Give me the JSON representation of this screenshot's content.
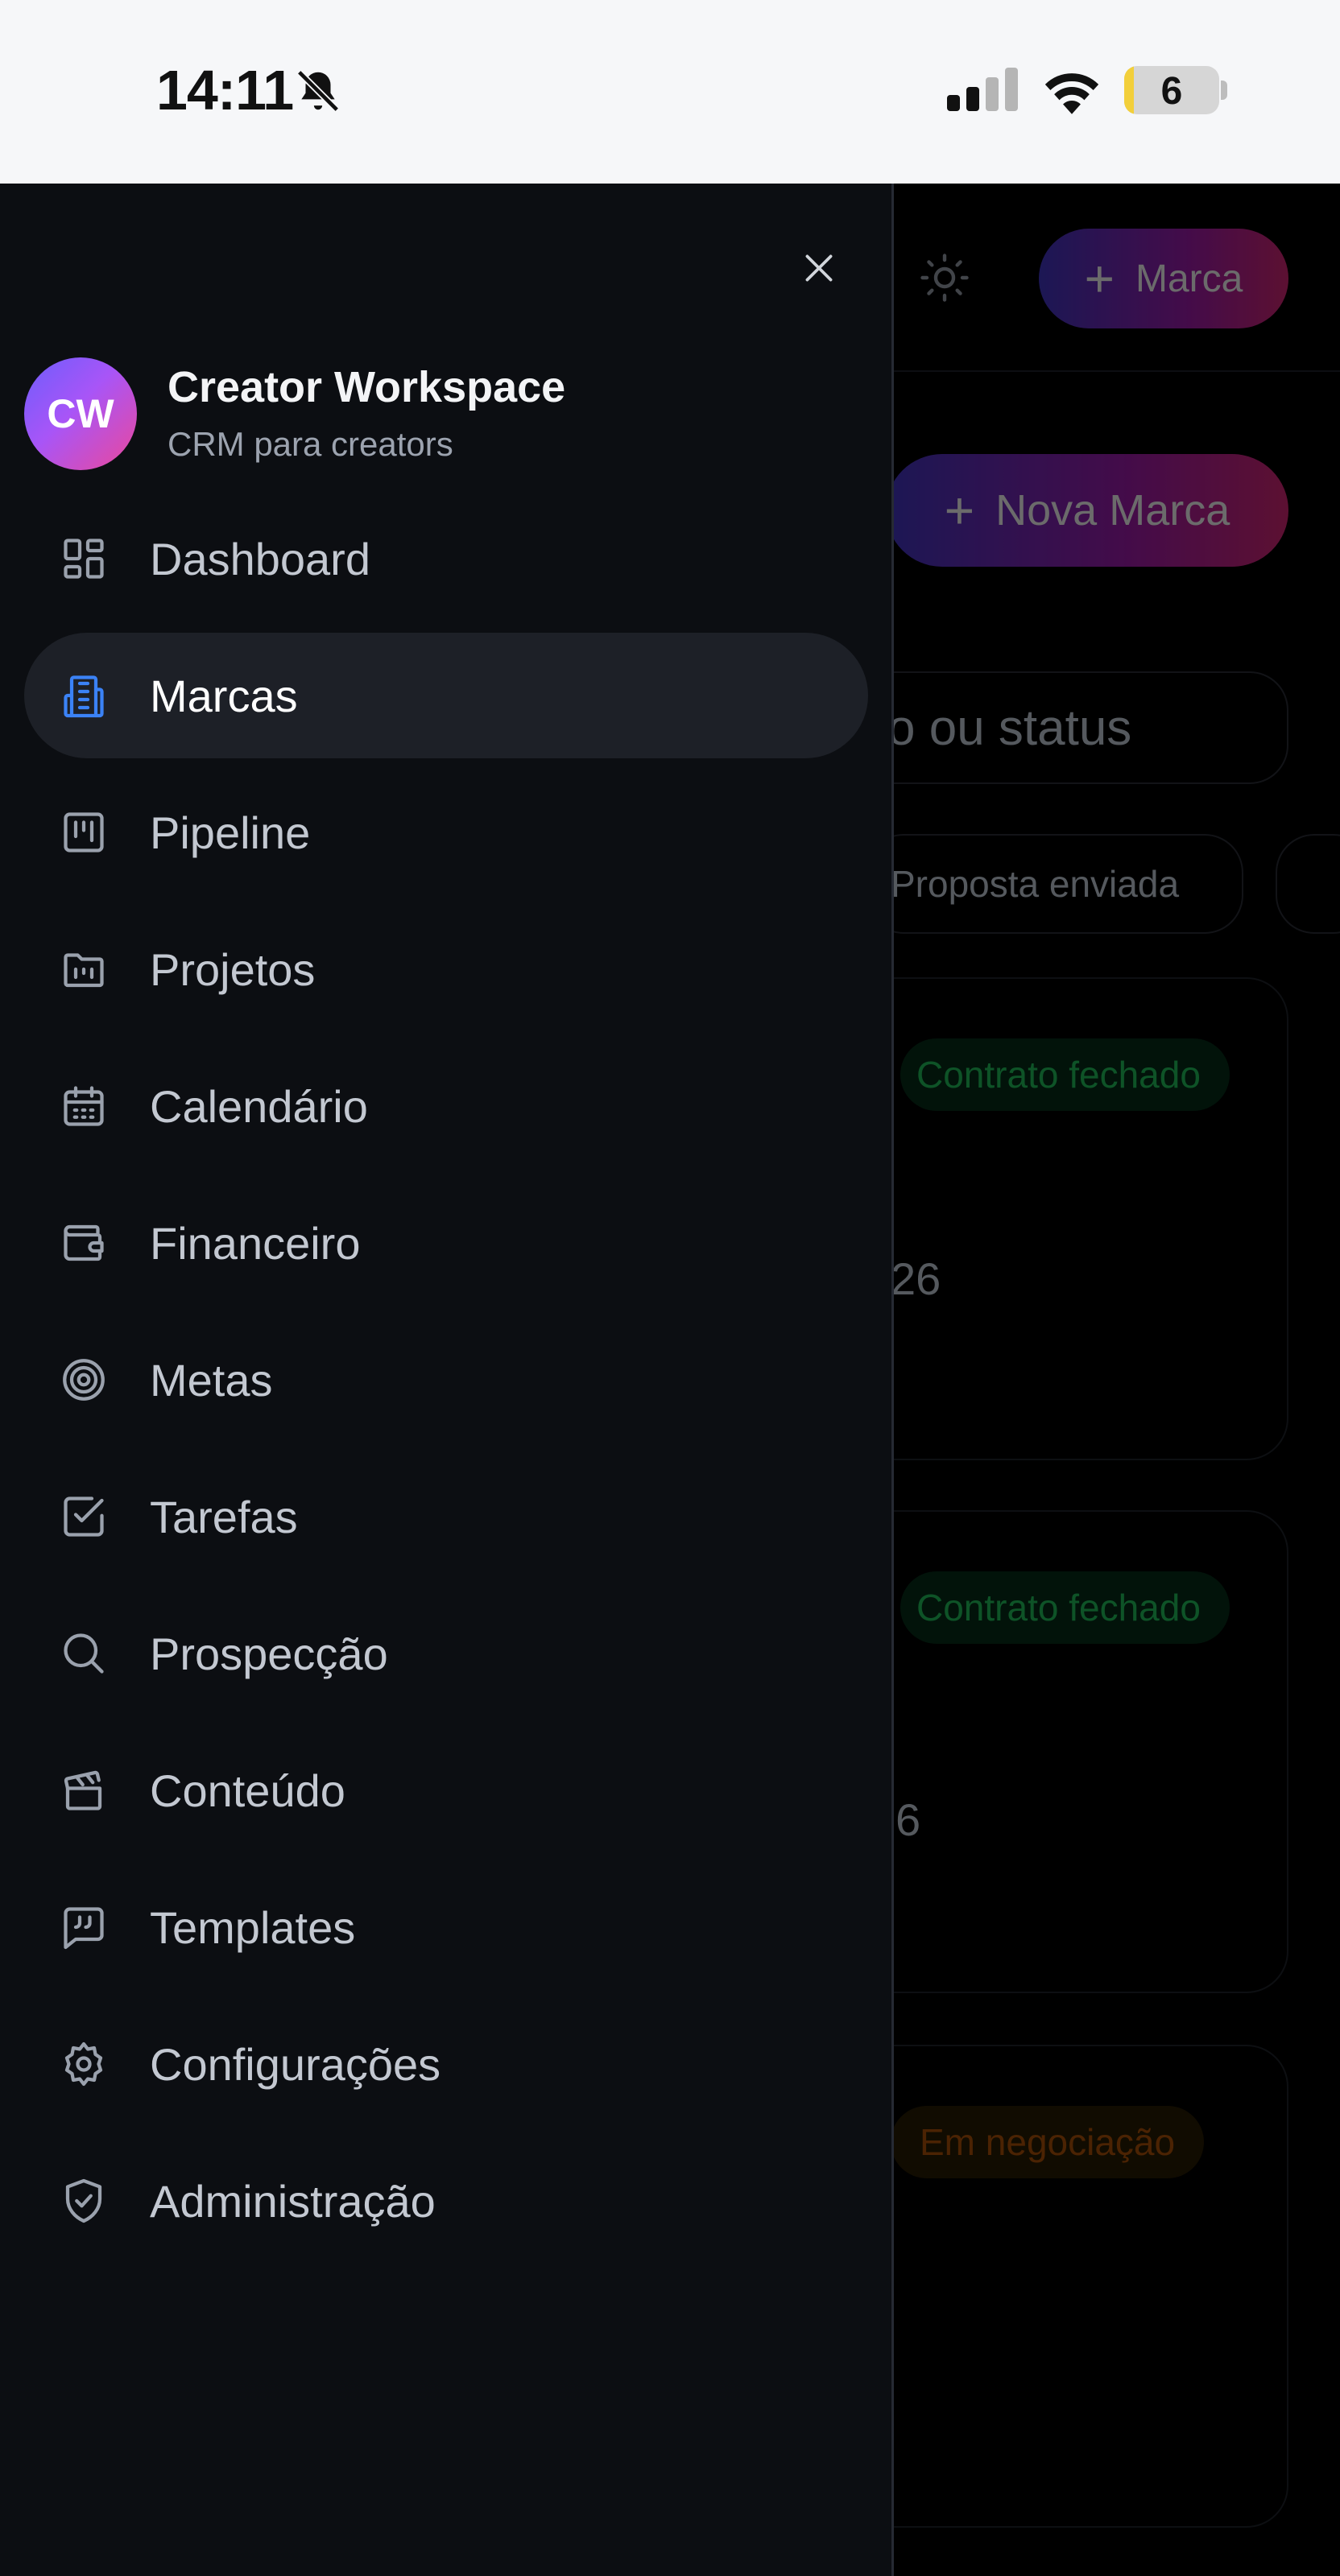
{
  "status_bar": {
    "time": "14:11",
    "battery": "6",
    "icons": [
      "bell-slash-icon",
      "signal-icon",
      "wifi-icon",
      "battery-icon"
    ]
  },
  "background_page": {
    "add_brand_button_label": "Marca",
    "new_brand_button_label": "Nova Marca",
    "search_placeholder_fragment": "o ou status",
    "filter_chip_label": "Proposta enviada",
    "cards": [
      {
        "badge": "Contrato fechado",
        "badge_color": "#22c55e",
        "number_fragment": "26"
      },
      {
        "badge": "Contrato fechado",
        "badge_color": "#22c55e",
        "number_fragment": "6"
      },
      {
        "badge": "Em negociação",
        "badge_color": "#b45309",
        "number_fragment": ""
      }
    ]
  },
  "drawer": {
    "workspace": {
      "initials": "CW",
      "name": "Creator Workspace",
      "subtitle": "CRM para creators"
    },
    "active_item": "Marcas",
    "accent_color": "#3b82f6",
    "items": [
      {
        "label": "Dashboard",
        "icon": "dashboard-icon"
      },
      {
        "label": "Marcas",
        "icon": "building-icon"
      },
      {
        "label": "Pipeline",
        "icon": "kanban-icon"
      },
      {
        "label": "Projetos",
        "icon": "folder-icon"
      },
      {
        "label": "Calendário",
        "icon": "calendar-icon"
      },
      {
        "label": "Financeiro",
        "icon": "wallet-icon"
      },
      {
        "label": "Metas",
        "icon": "target-icon"
      },
      {
        "label": "Tarefas",
        "icon": "checkbox-icon"
      },
      {
        "label": "Prospecção",
        "icon": "search-icon"
      },
      {
        "label": "Conteúdo",
        "icon": "clapperboard-icon"
      },
      {
        "label": "Templates",
        "icon": "message-quote-icon"
      },
      {
        "label": "Configurações",
        "icon": "gear-icon"
      },
      {
        "label": "Administração",
        "icon": "shield-check-icon"
      }
    ]
  }
}
